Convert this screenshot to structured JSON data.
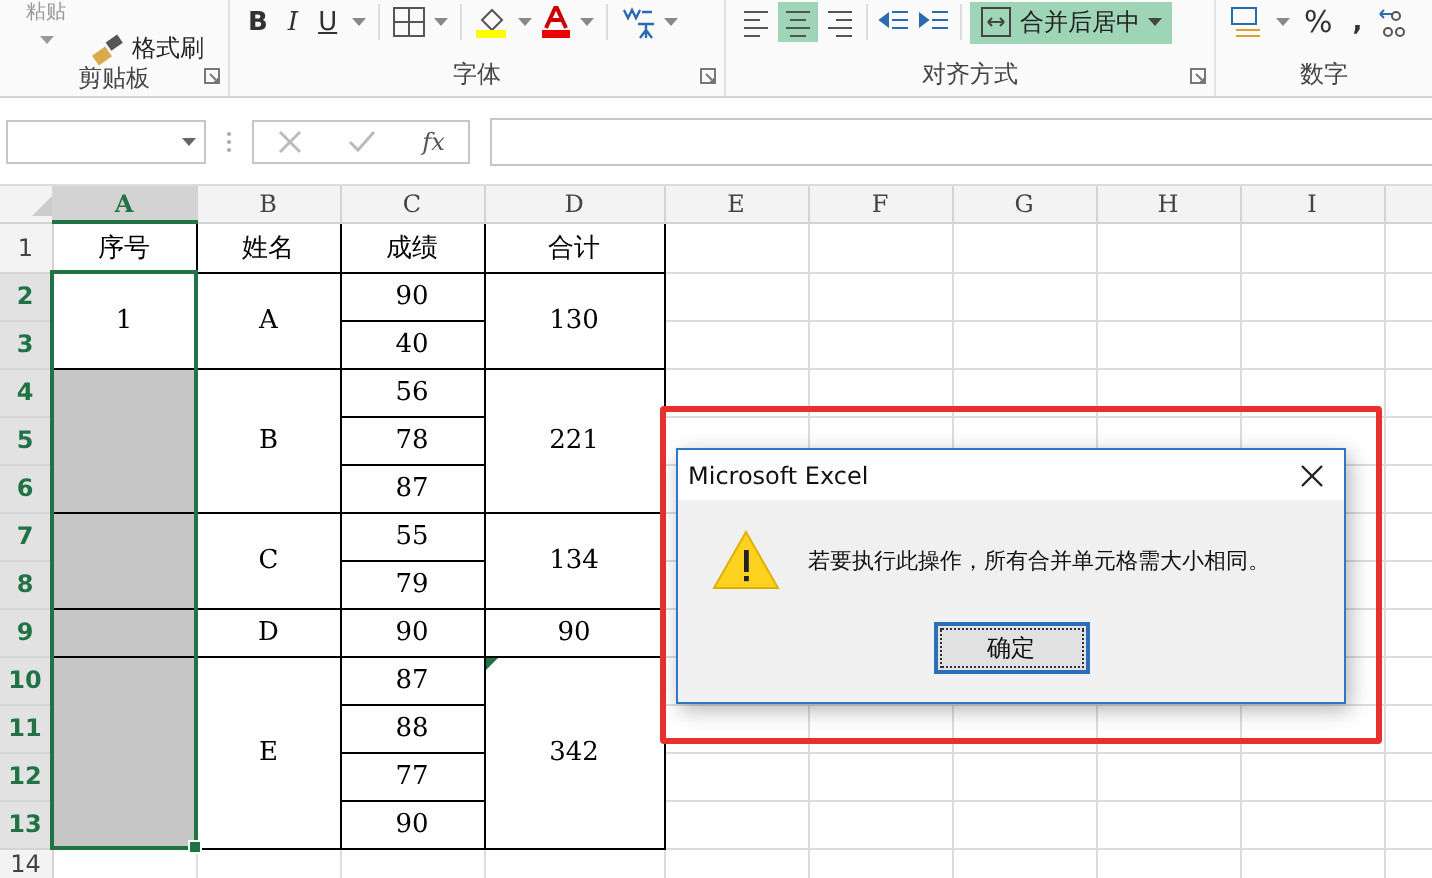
{
  "ribbon": {
    "groups": [
      {
        "label": "剪贴板",
        "kind": "clipboard",
        "paste_label": "粘贴",
        "format_painter": "格式刷"
      },
      {
        "label": "字体",
        "kind": "font",
        "bold": "B",
        "italic": "I",
        "underline": "U"
      },
      {
        "label": "对齐方式",
        "kind": "align",
        "merge_button": {
          "label": "合并后居中",
          "selected": true
        },
        "center_selected": true
      },
      {
        "label": "数字",
        "kind": "number",
        "percent": "%",
        "comma": ","
      }
    ]
  },
  "formula_bar": {
    "fx": "fx"
  },
  "grid": {
    "columns": [
      {
        "label": "A",
        "selected": true
      },
      {
        "label": "B",
        "selected": false
      },
      {
        "label": "C",
        "selected": false
      },
      {
        "label": "D",
        "selected": false
      },
      {
        "label": "E",
        "selected": false
      },
      {
        "label": "F",
        "selected": false
      },
      {
        "label": "G",
        "selected": false
      },
      {
        "label": "H",
        "selected": false
      },
      {
        "label": "I",
        "selected": false
      }
    ],
    "rows": [
      {
        "header": "1",
        "selected": false,
        "cells": [
          {
            "text": "序号"
          },
          {
            "text": "姓名"
          },
          {
            "text": "成绩"
          },
          {
            "text": "合计"
          }
        ]
      },
      {
        "header": "2",
        "selected": true,
        "cells": [
          {
            "text": "1",
            "rowspan": 2,
            "selected": true,
            "active": true
          },
          {
            "text": "A",
            "rowspan": 2
          },
          {
            "text": "90"
          },
          {
            "text": "130",
            "rowspan": 2
          }
        ]
      },
      {
        "header": "3",
        "selected": true,
        "cells": [
          {
            "text": "40"
          }
        ]
      },
      {
        "header": "4",
        "selected": true,
        "cells": [
          {
            "text": "",
            "rowspan": 3,
            "selected": true,
            "active": false
          },
          {
            "text": "B",
            "rowspan": 3
          },
          {
            "text": "56"
          },
          {
            "text": "221",
            "rowspan": 3
          }
        ]
      },
      {
        "header": "5",
        "selected": true,
        "cells": [
          {
            "text": "78"
          }
        ]
      },
      {
        "header": "6",
        "selected": true,
        "cells": [
          {
            "text": "87"
          }
        ]
      },
      {
        "header": "7",
        "selected": true,
        "cells": [
          {
            "text": "",
            "rowspan": 2,
            "selected": true,
            "active": false
          },
          {
            "text": "C",
            "rowspan": 2
          },
          {
            "text": "55"
          },
          {
            "text": "134",
            "rowspan": 2
          }
        ]
      },
      {
        "header": "8",
        "selected": true,
        "cells": [
          {
            "text": "79"
          }
        ]
      },
      {
        "header": "9",
        "selected": true,
        "cells": [
          {
            "text": "",
            "selected": true,
            "active": false
          },
          {
            "text": "D"
          },
          {
            "text": "90"
          },
          {
            "text": "90"
          }
        ]
      },
      {
        "header": "10",
        "selected": true,
        "cells": [
          {
            "text": "",
            "rowspan": 4,
            "selected": true,
            "active": false
          },
          {
            "text": "E",
            "rowspan": 4
          },
          {
            "text": "87"
          },
          {
            "text": "342",
            "rowspan": 4,
            "flag": true
          }
        ]
      },
      {
        "header": "11",
        "selected": true,
        "cells": [
          {
            "text": "88"
          }
        ]
      },
      {
        "header": "12",
        "selected": true,
        "cells": [
          {
            "text": "77"
          }
        ]
      },
      {
        "header": "13",
        "selected": true,
        "cells": [
          {
            "text": "90"
          }
        ]
      },
      {
        "header": "14",
        "selected": false,
        "cells": []
      }
    ]
  },
  "dialog": {
    "title": "Microsoft Excel",
    "message": "若要执行此操作，所有合并单元格需大小相同。",
    "button": "确定"
  }
}
